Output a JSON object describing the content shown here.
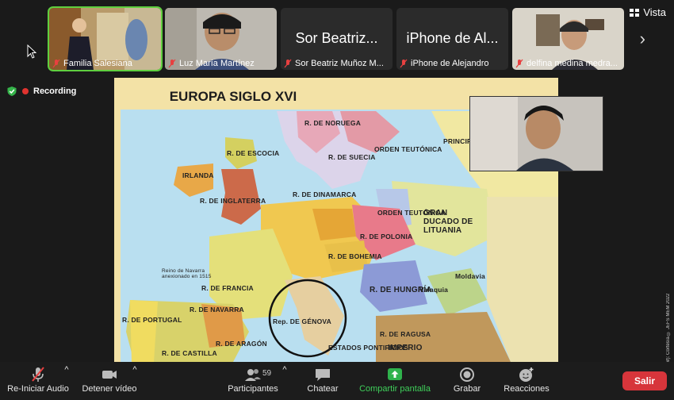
{
  "participants": [
    {
      "name": "Familia Salesiana"
    },
    {
      "name": "Luz María Martínez"
    },
    {
      "name": "Sor Beatriz Muñoz M...",
      "display": "Sor Beatriz..."
    },
    {
      "name": "iPhone de Alejandro",
      "display": "iPhone de Al..."
    },
    {
      "name": "delfina medina medra..."
    }
  ],
  "view_label": "Vista",
  "recording_label": "Recording",
  "map": {
    "title": "EUROPA SIGLO XVI",
    "labels": [
      "R. DE NORUEGA",
      "R. DE SUECIA",
      "ORDEN TEUTÓNICA",
      "PRINCIPADO DE MOSCÚ",
      "R. DE ESCOCIA",
      "IRLANDA",
      "R. DE INGLATERRA",
      "R. DE DINAMARCA",
      "ORDEN TEUTÓNICA",
      "GRAN DUCADO DE LITUANIA",
      "R. DE POLONIA",
      "R. DE BOHEMIA",
      "R. DE HUNGRÍA",
      "R. DE FRANCIA",
      "R. DE NAVARRA",
      "R. DE PORTUGAL",
      "R. DE ARAGÓN",
      "R. DE CASTILLA",
      "Rep. DE GÉNOVA",
      "Valaquia",
      "Moldavia",
      "R. DE RAGUSA",
      "IMPERIO",
      "ESTADOS PONTIFICIOS",
      "Reino de Navarra anexionado en 1515"
    ]
  },
  "watermark": "Zoom (TM): Cortesía © JEFS MEM 2022",
  "toolbar": {
    "audio_label": "Re-Iniciar Audio",
    "video_label": "Detener vídeo",
    "participants_label": "Participantes",
    "participants_count": "59",
    "chat_label": "Chatear",
    "share_label": "Compartir pantalla",
    "record_label": "Grabar",
    "reactions_label": "Reacciones",
    "leave_label": "Salir"
  },
  "colors": {
    "active_outline": "#5fcf3f",
    "share_green": "#2fb24c",
    "leave_red": "#d7353b",
    "recording_red": "#e0332f"
  }
}
